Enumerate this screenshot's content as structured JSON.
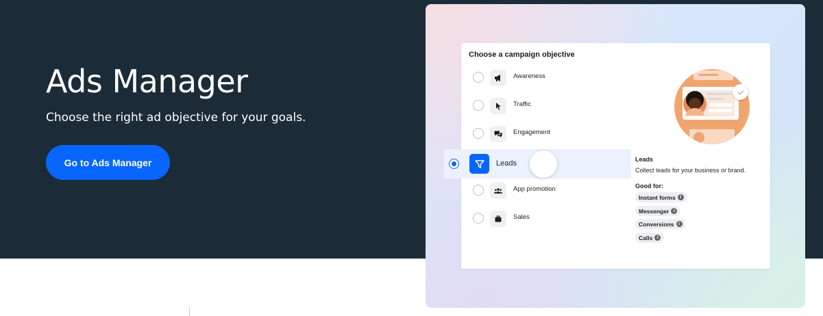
{
  "hero": {
    "title": "Ads Manager",
    "subtitle": "Choose the right ad objective for your goals.",
    "cta_label": "Go to Ads Manager",
    "background": "#1c2b38",
    "accent": "#0866ff"
  },
  "objective_card": {
    "title": "Choose a campaign objective",
    "options": [
      {
        "label": "Awareness",
        "icon": "megaphone-icon"
      },
      {
        "label": "Traffic",
        "icon": "cursor-icon"
      },
      {
        "label": "Engagement",
        "icon": "chat-bubbles-icon"
      },
      {
        "label": "Leads",
        "icon": "funnel-icon",
        "selected": true
      },
      {
        "label": "App promotion",
        "icon": "people-icon"
      },
      {
        "label": "Sales",
        "icon": "briefcase-icon"
      }
    ],
    "detail": {
      "title": "Leads",
      "description": "Collect leads for your business or brand.",
      "good_for_label": "Good for:",
      "chips": [
        "Instant forms",
        "Messenger",
        "Conversions",
        "Calls"
      ]
    }
  }
}
